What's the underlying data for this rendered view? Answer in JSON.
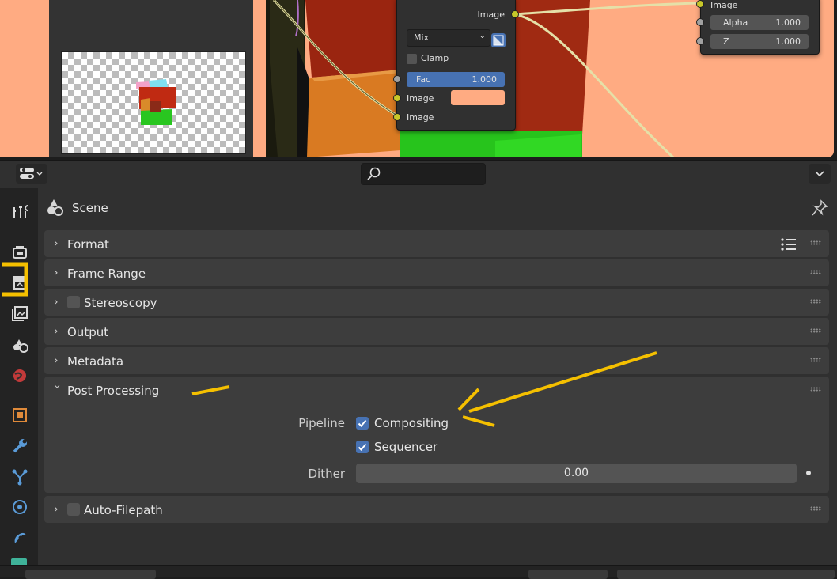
{
  "node_editor": {
    "mix_node": {
      "output_label": "Image",
      "blend_mode": "Mix",
      "clamp_label": "Clamp",
      "fac_label": "Fac",
      "fac_value": "1.000",
      "input1_label": "Image",
      "input2_label": "Image",
      "color_swatch": "#ffab82"
    },
    "composite_node": {
      "image_label": "Image",
      "alpha_label": "Alpha",
      "alpha_value": "1.000",
      "z_label": "Z",
      "z_value": "1.000"
    },
    "background_color": "#ffab82"
  },
  "header": {
    "search_placeholder": ""
  },
  "properties": {
    "context_title": "Scene",
    "panels": {
      "format": "Format",
      "frame_range": "Frame Range",
      "stereoscopy": "Stereoscopy",
      "output": "Output",
      "metadata": "Metadata",
      "post_processing": "Post Processing",
      "auto_filepath": "Auto-Filepath"
    },
    "post_processing": {
      "pipeline_label": "Pipeline",
      "compositing_label": "Compositing",
      "compositing_checked": true,
      "sequencer_label": "Sequencer",
      "sequencer_checked": true,
      "dither_label": "Dither",
      "dither_value": "0.00"
    },
    "stereoscopy_enabled": false,
    "auto_filepath_enabled": false
  },
  "tabs": [
    "tool-tab",
    "render-tab",
    "output-tab",
    "view-layer-tab",
    "scene-tab",
    "world-tab",
    "object-tab",
    "modifiers-tab",
    "particles-tab",
    "physics-tab",
    "constraints-tab"
  ],
  "annotation_color": "#f5c000",
  "accent_color": "#4772b3"
}
